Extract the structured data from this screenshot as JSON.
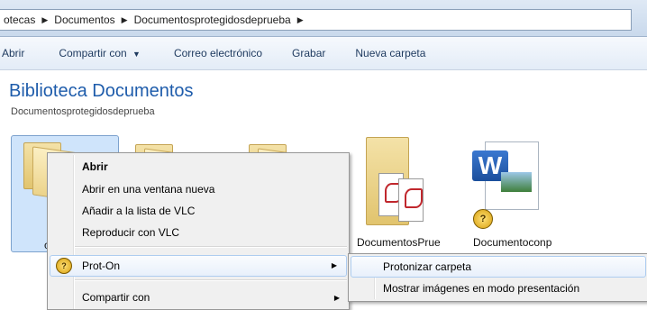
{
  "address_bar": {
    "crumbs": [
      "otecas",
      "Documentos",
      "Documentosprotegidosdeprueba"
    ],
    "separator": "▶"
  },
  "toolbar": {
    "open": "Abrir",
    "share": "Compartir con",
    "share_arrow": "▼",
    "email": "Correo electrónico",
    "burn": "Grabar",
    "new_folder": "Nueva carpeta"
  },
  "library": {
    "title": "Biblioteca Documentos",
    "subtitle": "Documentosprotegidosdeprueba"
  },
  "files": [
    {
      "label": "c",
      "icon": "folder-icon"
    },
    {
      "label": "",
      "icon": "folder-icon"
    },
    {
      "label": "",
      "icon": "folder-icon"
    },
    {
      "label": "DocumentosPrue",
      "icon": "pdf-folder-icon"
    },
    {
      "label": "Documentoconp",
      "icon": "word-document-icon"
    }
  ],
  "context_menu": {
    "items": [
      {
        "label": "Abrir",
        "bold": true
      },
      {
        "label": "Abrir en una ventana nueva"
      },
      {
        "label": "Añadir a la lista de VLC"
      },
      {
        "label": "Reproducir con VLC"
      },
      {
        "label": "Prot-On",
        "submenu": true,
        "highlighted": true,
        "icon": "prot-on-icon"
      },
      {
        "label": "Compartir con",
        "submenu": true
      }
    ],
    "submenu_arrow": "▶"
  },
  "submenu": {
    "items": [
      {
        "label": "Protonizar carpeta",
        "highlighted": true
      },
      {
        "label": "Mostrar imágenes en modo presentación"
      }
    ]
  },
  "colors": {
    "title_blue": "#1e5cab",
    "highlight_border": "#aecdf0",
    "selection_fill": "#cfe4fb",
    "prot_on_badge": "#e5b224"
  }
}
